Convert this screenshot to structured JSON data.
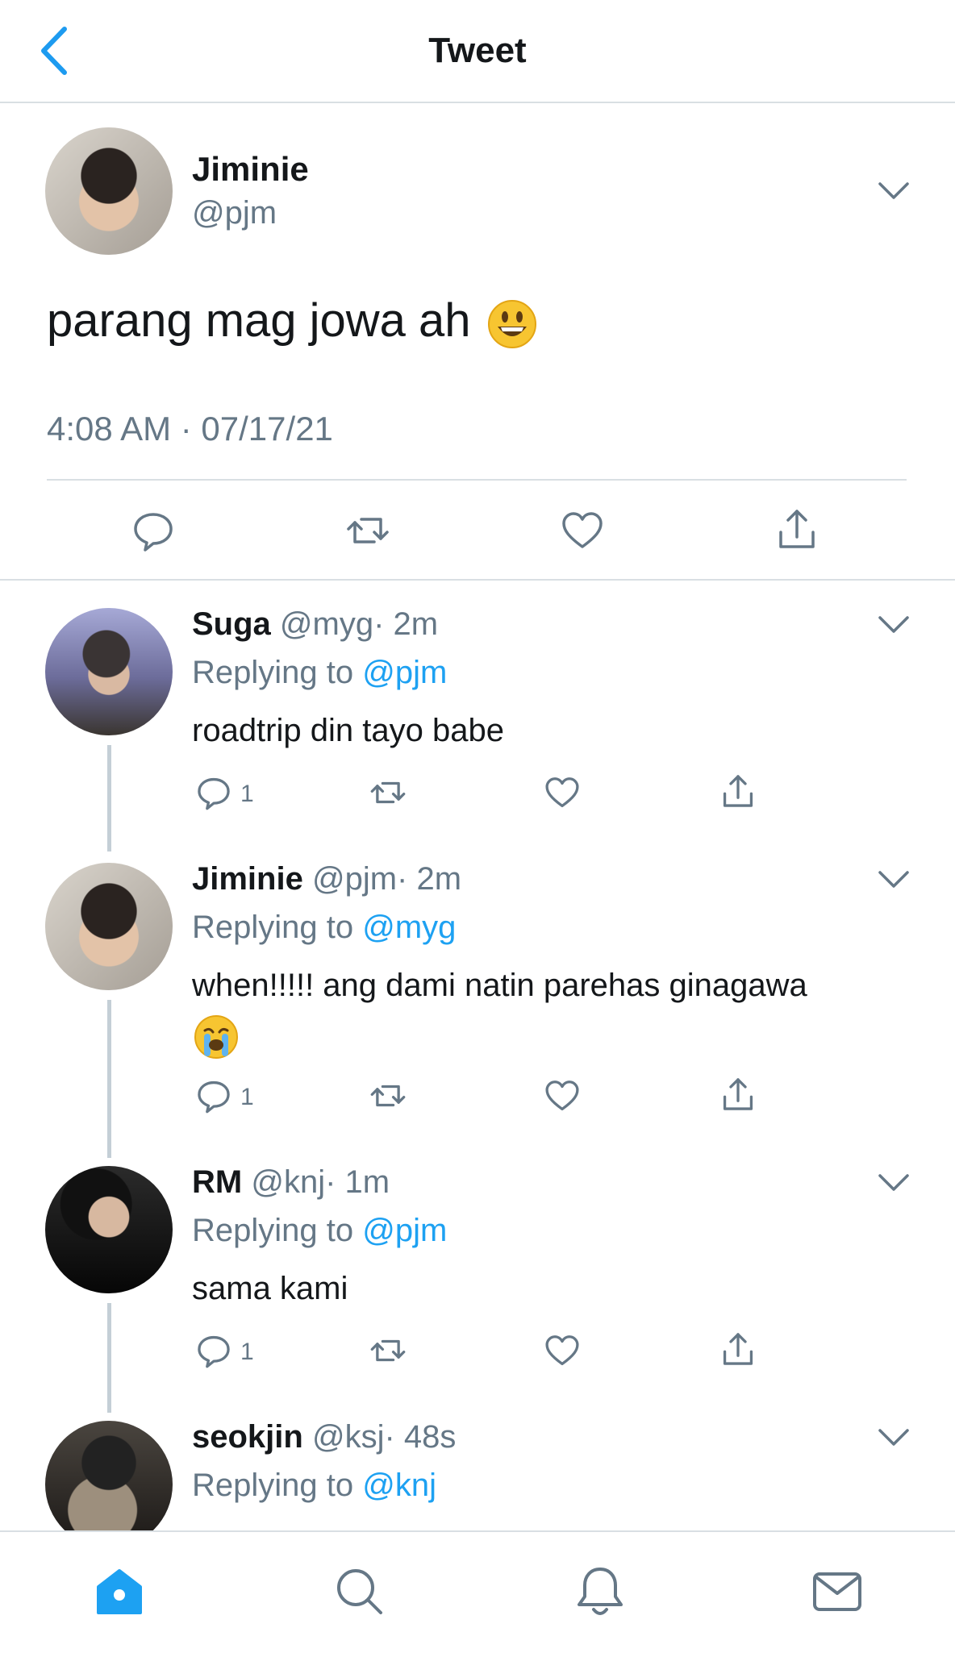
{
  "header": {
    "title": "Tweet"
  },
  "main_tweet": {
    "name": "Jiminie",
    "handle": "@pjm",
    "text": "parang mag jowa ah",
    "emoji": "grinning-face-emoji",
    "timestamp": "4:08 AM · 07/17/21"
  },
  "replies": [
    {
      "name": "Suga",
      "handle": "@myg",
      "time": "· 2m",
      "replying_label": "Replying to",
      "replying_to": "@pjm",
      "text": "roadtrip din tayo babe",
      "reply_count": "1"
    },
    {
      "name": "Jiminie",
      "handle": "@pjm",
      "time": "· 2m",
      "replying_label": "Replying to",
      "replying_to": "@myg",
      "text": "when!!!!! ang dami natin parehas ginagawa",
      "emoji": "loudly-crying-face-emoji",
      "reply_count": "1"
    },
    {
      "name": "RM",
      "handle": "@knj",
      "time": "· 1m",
      "replying_label": "Replying to",
      "replying_to": "@pjm",
      "text": "sama kami",
      "reply_count": "1"
    },
    {
      "name": "seokjin",
      "handle": "@ksj",
      "time": "· 48s",
      "replying_label": "Replying to",
      "replying_to": "@knj"
    }
  ],
  "bottom_nav": [
    "home-icon",
    "search-icon",
    "notifications-bell-icon",
    "messages-envelope-icon"
  ],
  "colors": {
    "accent": "#1da1f2",
    "muted": "#657786",
    "text": "#14171a",
    "divider": "#d9dfe3"
  }
}
